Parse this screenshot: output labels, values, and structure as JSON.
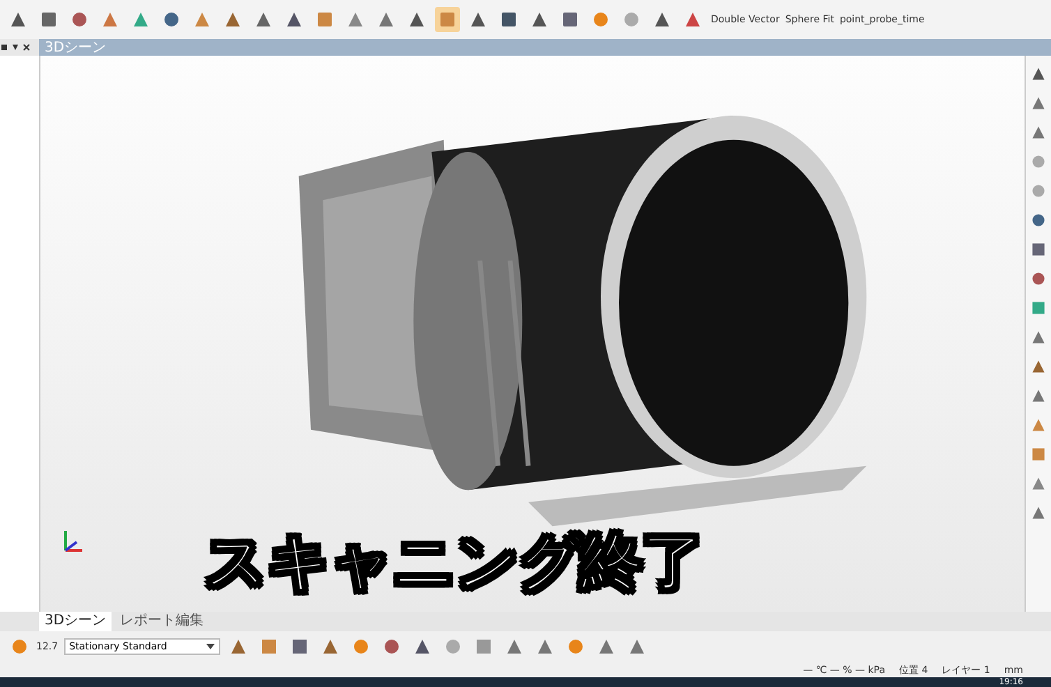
{
  "toolbar": {
    "labels": [
      "Double Vector",
      "Sphere Fit",
      "point_probe_time"
    ]
  },
  "scene_panel": {
    "title": "3Dシーン"
  },
  "caption": "スキャニング終了",
  "bottom_tabs": [
    {
      "label": "3Dシーン",
      "selected": true
    },
    {
      "label": "レポート編集",
      "selected": false
    }
  ],
  "bottom_toolbar": {
    "reading": "12.7",
    "profile": "Stationary Standard"
  },
  "status_bar": {
    "weather": "— ℃ — % — kPa",
    "position": "位置 4",
    "layer": "レイヤー 1",
    "unit": "mm"
  },
  "taskbar": {
    "time": "19:16"
  }
}
